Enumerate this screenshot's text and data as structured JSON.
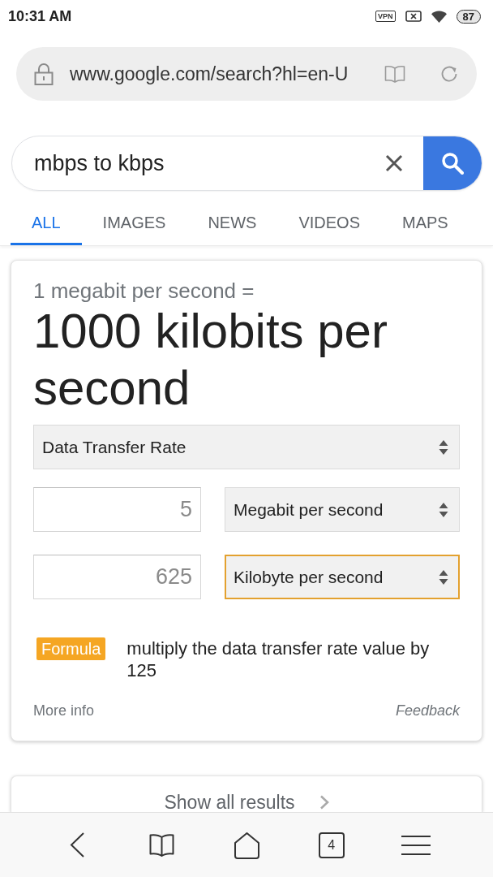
{
  "status_bar": {
    "time": "10:31 AM",
    "vpn": "VPN",
    "battery": "87"
  },
  "address_bar": {
    "url": "www.google.com/search?hl=en-U"
  },
  "search": {
    "query": "mbps to kbps"
  },
  "tabs": [
    {
      "label": "ALL",
      "selected": true
    },
    {
      "label": "IMAGES",
      "selected": false
    },
    {
      "label": "NEWS",
      "selected": false
    },
    {
      "label": "VIDEOS",
      "selected": false
    },
    {
      "label": "MAPS",
      "selected": false
    }
  ],
  "converter": {
    "equation": "1 megabit per second =",
    "result": "1000 kilobits per second",
    "category": {
      "value": "Data Transfer Rate",
      "focused": false
    },
    "rows": [
      {
        "amount": "5",
        "unit": {
          "value": "Megabit per second",
          "focused": false
        }
      },
      {
        "amount": "625",
        "unit": {
          "value": "Kilobyte per second",
          "focused": true
        }
      }
    ],
    "formula": {
      "label": "Formula",
      "text": "multiply the data transfer rate value by 125"
    },
    "more_info": "More info",
    "feedback": "Feedback"
  },
  "more_results": {
    "label": "Show all results"
  },
  "bottom_toolbar": {
    "tab_count": "4"
  }
}
